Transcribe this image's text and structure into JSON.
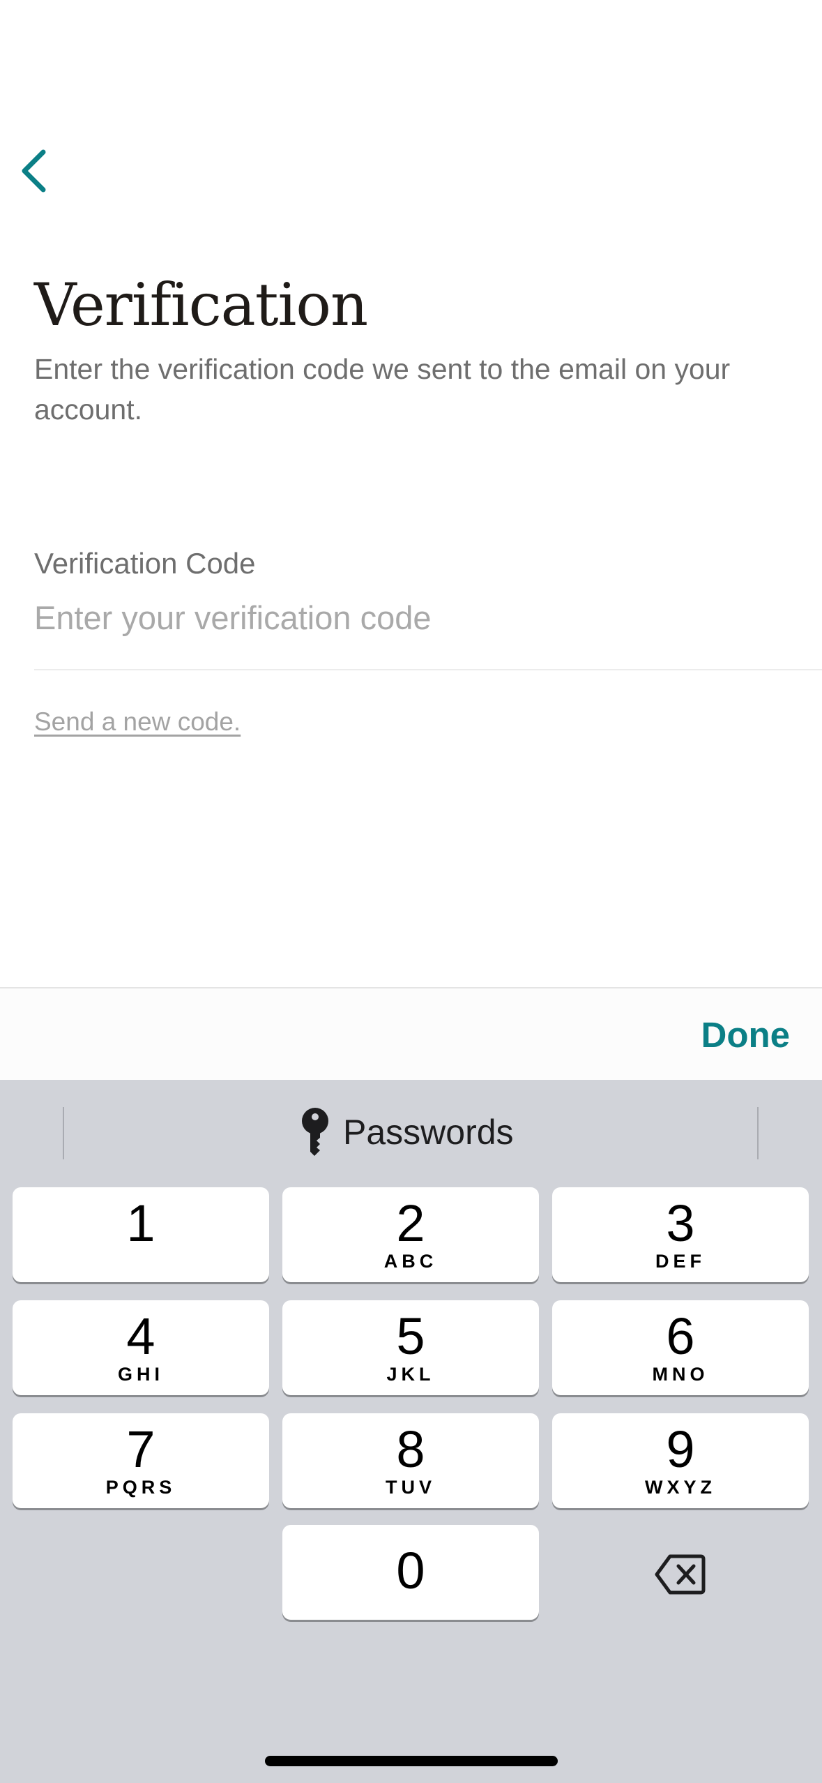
{
  "header": {
    "back_icon": "chevron-left-icon",
    "title": "Verification",
    "subtitle": "Enter the verification code we sent to the email on your account."
  },
  "form": {
    "field_label": "Verification Code",
    "field_placeholder": "Enter your verification code",
    "field_value": "",
    "resend_link": "Send a new code."
  },
  "accessory_bar": {
    "done_label": "Done"
  },
  "keyboard": {
    "suggestion": {
      "icon": "key-icon",
      "label": "Passwords"
    },
    "keys": [
      {
        "digit": "1",
        "letters": ""
      },
      {
        "digit": "2",
        "letters": "ABC"
      },
      {
        "digit": "3",
        "letters": "DEF"
      },
      {
        "digit": "4",
        "letters": "GHI"
      },
      {
        "digit": "5",
        "letters": "JKL"
      },
      {
        "digit": "6",
        "letters": "MNO"
      },
      {
        "digit": "7",
        "letters": "PQRS"
      },
      {
        "digit": "8",
        "letters": "TUV"
      },
      {
        "digit": "9",
        "letters": "WXYZ"
      },
      {
        "digit": "0",
        "letters": ""
      }
    ],
    "delete_icon": "backspace-icon"
  },
  "colors": {
    "accent": "#0b7f86",
    "title": "#1f1b18",
    "muted_text": "#6e6e6e",
    "keyboard_bg": "#d1d3d9"
  }
}
